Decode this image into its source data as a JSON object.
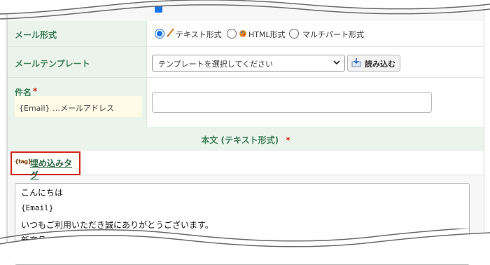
{
  "form": {
    "mail_format": {
      "label": "メール形式",
      "options": [
        {
          "label": "テキスト形式",
          "selected": true,
          "icon": "pencil-icon"
        },
        {
          "label": "HTML形式",
          "selected": false,
          "icon": "palette-icon"
        },
        {
          "label": "マルチパート形式",
          "selected": false
        }
      ]
    },
    "mail_template": {
      "label": "メールテンプレート",
      "select_value": "テンプレートを選択してください",
      "load_button": "読み込む"
    },
    "subject": {
      "label": "件名",
      "required_mark": "*",
      "hint": "{Email} …メールアドレス",
      "value": ""
    }
  },
  "body_section": {
    "title": "本文 (テキスト形式)",
    "required_mark": "*",
    "embed_tag_link": "埋め込みタグ",
    "tag_icon_text": "{tag}",
    "lines": [
      "こんにちは",
      "{Email}",
      "いつもご利用いただき誠にありがとうございます。",
      "新商品のご紹介です。"
    ]
  },
  "colors": {
    "label_bg": "#eaf4ea",
    "label_text": "#3f7f5a",
    "highlight_border": "#d0261b",
    "radio_accent": "#1a73e8"
  }
}
